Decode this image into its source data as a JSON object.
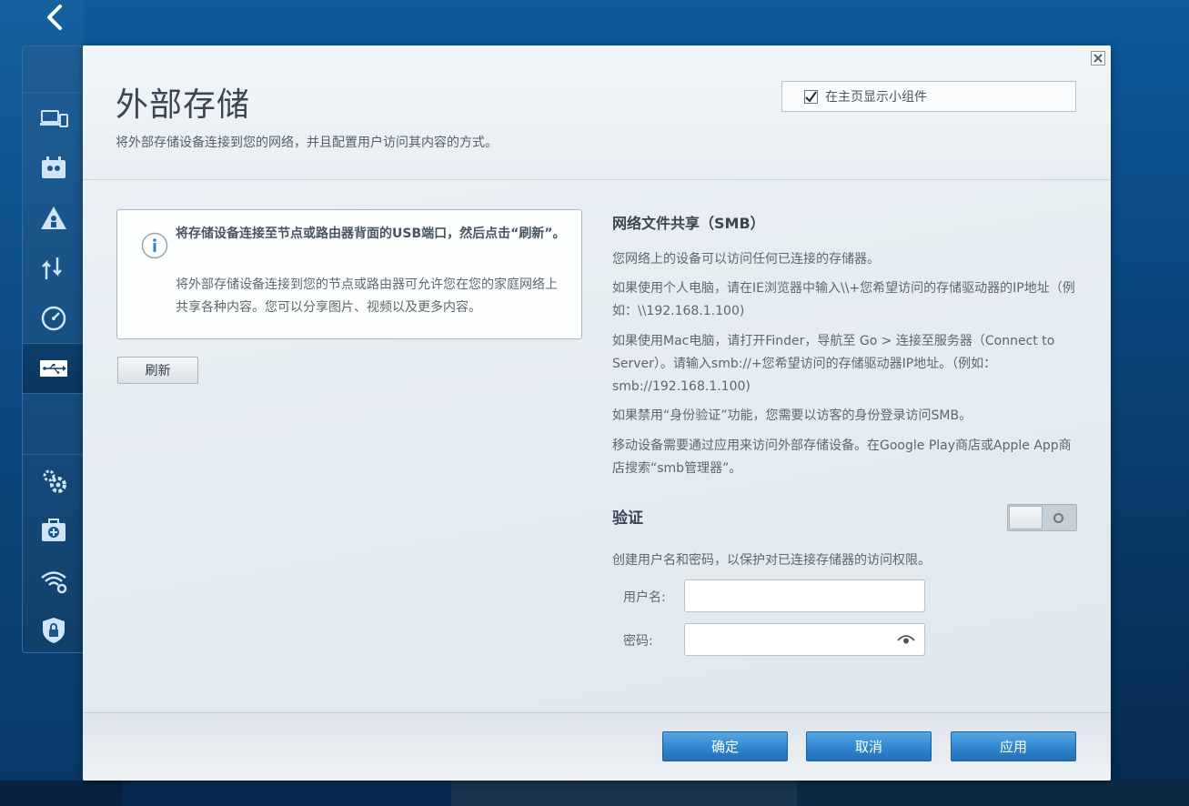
{
  "modal": {
    "title": "外部存储",
    "subtitle": "将外部存储设备连接到您的网络，并且配置用户访问其内容的方式。",
    "show_widget_label": "在主页显示小组件",
    "show_widget_checked": true
  },
  "info": {
    "title": "将存储设备连接至节点或路由器背面的USB端口，然后点击“刷新”。",
    "text": "将外部存储设备连接到您的节点或路由器可允许您在您的家庭网络上共享各种内容。您可以分享图片、视频以及更多内容。"
  },
  "refresh_label": "刷新",
  "smb": {
    "title": "网络文件共享（SMB）",
    "p1": "您网络上的设备可以访问任何已连接的存储器。",
    "p2": "如果使用个人电脑，请在IE浏览器中输入\\\\+您希望访问的存储驱动器的IP地址（例如：\\\\192.168.1.100)",
    "p3": "如果使用Mac电脑，请打开Finder，导航至 Go > 连接至服务器（Connect to Server）。请输入smb://+您希望访问的存储驱动器IP地址。（例如：smb://192.168.1.100)",
    "p4": "如果禁用“身份验证”功能，您需要以访客的身份登录访问SMB。",
    "p5": "移动设备需要通过应用来访问外部存储设备。在Google Play商店或Apple App商店搜索“smb管理器”。"
  },
  "auth": {
    "title": "验证",
    "toggle_on": false,
    "description": "创建用户名和密码，以保护对已连接存储器的访问权限。",
    "username_label": "用户名:",
    "username_value": "",
    "password_label": "密码:",
    "password_value": ""
  },
  "footer": {
    "ok_label": "确定",
    "cancel_label": "取消",
    "apply_label": "应用"
  },
  "colors": {
    "primary_button": "#2f86cf",
    "background": "#0a4a84"
  }
}
